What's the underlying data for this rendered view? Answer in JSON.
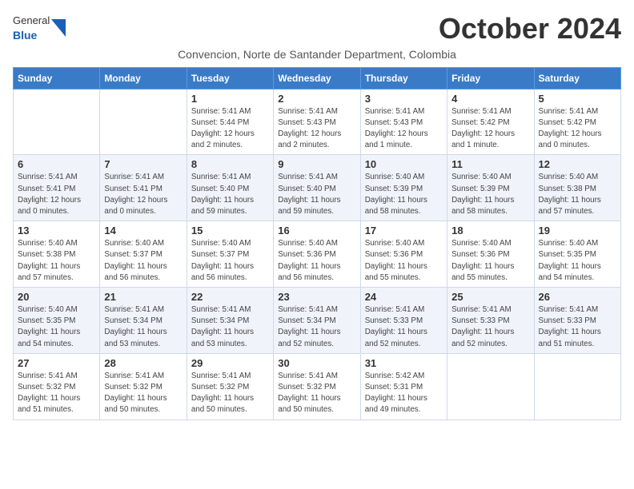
{
  "logo": {
    "general": "General",
    "blue": "Blue"
  },
  "header": {
    "month": "October 2024",
    "location": "Convencion, Norte de Santander Department, Colombia"
  },
  "weekdays": [
    "Sunday",
    "Monday",
    "Tuesday",
    "Wednesday",
    "Thursday",
    "Friday",
    "Saturday"
  ],
  "weeks": [
    [
      {
        "day": "",
        "info": ""
      },
      {
        "day": "",
        "info": ""
      },
      {
        "day": "1",
        "info": "Sunrise: 5:41 AM\nSunset: 5:44 PM\nDaylight: 12 hours\nand 2 minutes."
      },
      {
        "day": "2",
        "info": "Sunrise: 5:41 AM\nSunset: 5:43 PM\nDaylight: 12 hours\nand 2 minutes."
      },
      {
        "day": "3",
        "info": "Sunrise: 5:41 AM\nSunset: 5:43 PM\nDaylight: 12 hours\nand 1 minute."
      },
      {
        "day": "4",
        "info": "Sunrise: 5:41 AM\nSunset: 5:42 PM\nDaylight: 12 hours\nand 1 minute."
      },
      {
        "day": "5",
        "info": "Sunrise: 5:41 AM\nSunset: 5:42 PM\nDaylight: 12 hours\nand 0 minutes."
      }
    ],
    [
      {
        "day": "6",
        "info": "Sunrise: 5:41 AM\nSunset: 5:41 PM\nDaylight: 12 hours\nand 0 minutes."
      },
      {
        "day": "7",
        "info": "Sunrise: 5:41 AM\nSunset: 5:41 PM\nDaylight: 12 hours\nand 0 minutes."
      },
      {
        "day": "8",
        "info": "Sunrise: 5:41 AM\nSunset: 5:40 PM\nDaylight: 11 hours\nand 59 minutes."
      },
      {
        "day": "9",
        "info": "Sunrise: 5:41 AM\nSunset: 5:40 PM\nDaylight: 11 hours\nand 59 minutes."
      },
      {
        "day": "10",
        "info": "Sunrise: 5:40 AM\nSunset: 5:39 PM\nDaylight: 11 hours\nand 58 minutes."
      },
      {
        "day": "11",
        "info": "Sunrise: 5:40 AM\nSunset: 5:39 PM\nDaylight: 11 hours\nand 58 minutes."
      },
      {
        "day": "12",
        "info": "Sunrise: 5:40 AM\nSunset: 5:38 PM\nDaylight: 11 hours\nand 57 minutes."
      }
    ],
    [
      {
        "day": "13",
        "info": "Sunrise: 5:40 AM\nSunset: 5:38 PM\nDaylight: 11 hours\nand 57 minutes."
      },
      {
        "day": "14",
        "info": "Sunrise: 5:40 AM\nSunset: 5:37 PM\nDaylight: 11 hours\nand 56 minutes."
      },
      {
        "day": "15",
        "info": "Sunrise: 5:40 AM\nSunset: 5:37 PM\nDaylight: 11 hours\nand 56 minutes."
      },
      {
        "day": "16",
        "info": "Sunrise: 5:40 AM\nSunset: 5:36 PM\nDaylight: 11 hours\nand 56 minutes."
      },
      {
        "day": "17",
        "info": "Sunrise: 5:40 AM\nSunset: 5:36 PM\nDaylight: 11 hours\nand 55 minutes."
      },
      {
        "day": "18",
        "info": "Sunrise: 5:40 AM\nSunset: 5:36 PM\nDaylight: 11 hours\nand 55 minutes."
      },
      {
        "day": "19",
        "info": "Sunrise: 5:40 AM\nSunset: 5:35 PM\nDaylight: 11 hours\nand 54 minutes."
      }
    ],
    [
      {
        "day": "20",
        "info": "Sunrise: 5:40 AM\nSunset: 5:35 PM\nDaylight: 11 hours\nand 54 minutes."
      },
      {
        "day": "21",
        "info": "Sunrise: 5:41 AM\nSunset: 5:34 PM\nDaylight: 11 hours\nand 53 minutes."
      },
      {
        "day": "22",
        "info": "Sunrise: 5:41 AM\nSunset: 5:34 PM\nDaylight: 11 hours\nand 53 minutes."
      },
      {
        "day": "23",
        "info": "Sunrise: 5:41 AM\nSunset: 5:34 PM\nDaylight: 11 hours\nand 52 minutes."
      },
      {
        "day": "24",
        "info": "Sunrise: 5:41 AM\nSunset: 5:33 PM\nDaylight: 11 hours\nand 52 minutes."
      },
      {
        "day": "25",
        "info": "Sunrise: 5:41 AM\nSunset: 5:33 PM\nDaylight: 11 hours\nand 52 minutes."
      },
      {
        "day": "26",
        "info": "Sunrise: 5:41 AM\nSunset: 5:33 PM\nDaylight: 11 hours\nand 51 minutes."
      }
    ],
    [
      {
        "day": "27",
        "info": "Sunrise: 5:41 AM\nSunset: 5:32 PM\nDaylight: 11 hours\nand 51 minutes."
      },
      {
        "day": "28",
        "info": "Sunrise: 5:41 AM\nSunset: 5:32 PM\nDaylight: 11 hours\nand 50 minutes."
      },
      {
        "day": "29",
        "info": "Sunrise: 5:41 AM\nSunset: 5:32 PM\nDaylight: 11 hours\nand 50 minutes."
      },
      {
        "day": "30",
        "info": "Sunrise: 5:41 AM\nSunset: 5:32 PM\nDaylight: 11 hours\nand 50 minutes."
      },
      {
        "day": "31",
        "info": "Sunrise: 5:42 AM\nSunset: 5:31 PM\nDaylight: 11 hours\nand 49 minutes."
      },
      {
        "day": "",
        "info": ""
      },
      {
        "day": "",
        "info": ""
      }
    ]
  ]
}
